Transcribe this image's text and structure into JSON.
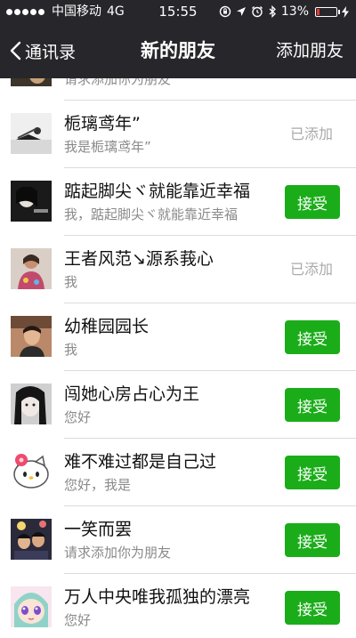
{
  "status_bar": {
    "carrier": "中国移动",
    "network": "4G",
    "time": "15:55",
    "battery_percent": "13%",
    "battery_level": 0.13,
    "battery_color": "#e53935"
  },
  "nav": {
    "back_label": "通讯录",
    "title": "新的朋友",
    "action_label": "添加朋友"
  },
  "colors": {
    "header_bg": "#26262b",
    "accept_green": "#1aad19",
    "added_gray": "#aaaaaa",
    "subtitle_gray": "#8a8a8a",
    "separator": "#dcdcdc"
  },
  "requests": [
    {
      "name": "",
      "message": "请求添加你为朋友",
      "status": "none",
      "status_label": ""
    },
    {
      "name": "栀璃鸢年”",
      "message": "我是栀璃鸢年”",
      "status": "added",
      "status_label": "已添加"
    },
    {
      "name": "踮起脚尖ヾ就能靠近幸福",
      "message": "我，踮起脚尖ヾ就能靠近幸福",
      "status": "pending",
      "status_label": "接受"
    },
    {
      "name": "王者风范↘源系莪心",
      "message": "我",
      "status": "added",
      "status_label": "已添加"
    },
    {
      "name": "幼稚园园长",
      "message": "我",
      "status": "pending",
      "status_label": "接受"
    },
    {
      "name": "闯她心房占心为王",
      "message": "您好",
      "status": "pending",
      "status_label": "接受"
    },
    {
      "name": "难不难过都是自己过",
      "message": "您好，我是",
      "status": "pending",
      "status_label": "接受"
    },
    {
      "name": "一笑而罢",
      "message": "请求添加你为朋友",
      "status": "pending",
      "status_label": "接受"
    },
    {
      "name": "万人中央唯我孤独的漂亮",
      "message": "您好",
      "status": "pending",
      "status_label": "接受"
    }
  ]
}
